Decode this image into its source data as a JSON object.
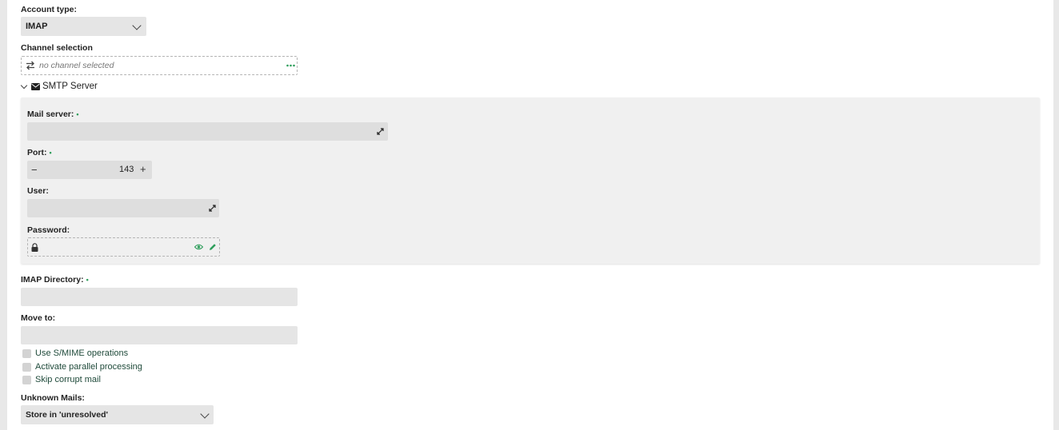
{
  "account_type": {
    "label": "Account type:",
    "value": "IMAP"
  },
  "channel_selection": {
    "label": "Channel selection",
    "placeholder": "no channel selected"
  },
  "smtp_section": {
    "title": "SMTP Server",
    "mail_server": {
      "label": "Mail server:",
      "required_mark": "•",
      "value": ""
    },
    "port": {
      "label": "Port:",
      "required_mark": "•",
      "value": "143",
      "minus": "−",
      "plus": "+"
    },
    "user": {
      "label": "User:",
      "value": ""
    },
    "password": {
      "label": "Password:",
      "value": ""
    }
  },
  "imap_directory": {
    "label": "IMAP Directory:",
    "required_mark": "•",
    "value": ""
  },
  "move_to": {
    "label": "Move to:",
    "value": ""
  },
  "options": [
    {
      "label": "Use S/MIME operations",
      "checked": false
    },
    {
      "label": "Activate parallel processing",
      "checked": false
    },
    {
      "label": "Skip corrupt mail",
      "checked": false
    }
  ],
  "unknown_mails": {
    "label": "Unknown Mails:",
    "value": "Store in 'unresolved'"
  },
  "colors": {
    "accent": "#2e9e5b",
    "field_bg": "#e5e5e5",
    "section_bg": "#f0f0f0"
  },
  "icons": {
    "channel": "swap-arrows-icon",
    "more": "more-dots-icon",
    "collapse": "chevron-down-icon",
    "envelope": "envelope-icon",
    "expand": "expand-diagonal-icon",
    "lock": "lock-icon",
    "eye": "eye-icon",
    "pencil": "pencil-icon"
  }
}
